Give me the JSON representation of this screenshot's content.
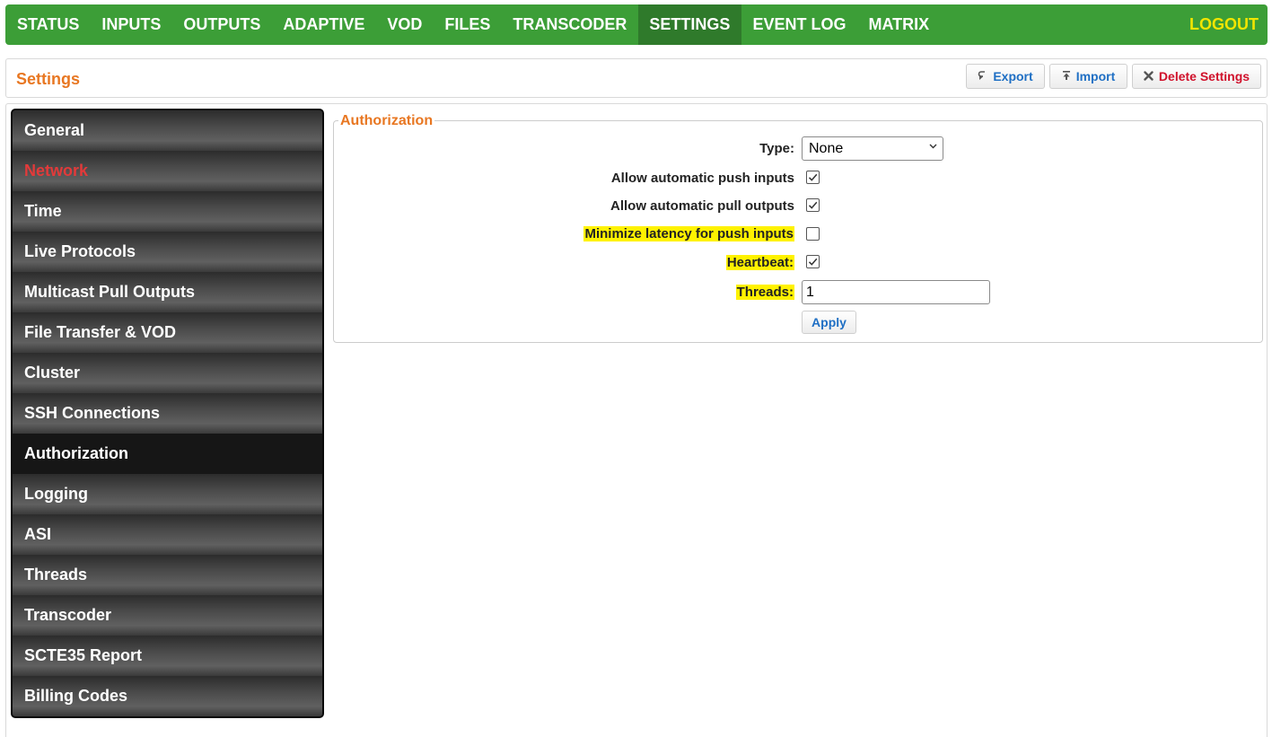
{
  "nav": {
    "items": [
      "STATUS",
      "INPUTS",
      "OUTPUTS",
      "ADAPTIVE",
      "VOD",
      "FILES",
      "TRANSCODER",
      "SETTINGS",
      "EVENT LOG",
      "MATRIX"
    ],
    "active": "SETTINGS",
    "logout": "LOGOUT"
  },
  "header": {
    "title": "Settings",
    "export_label": "Export",
    "import_label": "Import",
    "delete_label": "Delete Settings"
  },
  "sidebar": {
    "items": [
      "General",
      "Network",
      "Time",
      "Live Protocols",
      "Multicast Pull Outputs",
      "File Transfer & VOD",
      "Cluster",
      "SSH Connections",
      "Authorization",
      "Logging",
      "ASI",
      "Threads",
      "Transcoder",
      "SCTE35 Report",
      "Billing Codes"
    ],
    "active": "Authorization",
    "highlighted": "Network"
  },
  "form": {
    "legend": "Authorization",
    "type_label": "Type:",
    "type_value": "None",
    "push_label": "Allow automatic push inputs",
    "push_checked": true,
    "pull_label": "Allow automatic pull outputs",
    "pull_checked": true,
    "latency_label": "Minimize latency for push inputs",
    "latency_checked": false,
    "heartbeat_label": "Heartbeat:",
    "heartbeat_checked": true,
    "threads_label": "Threads:",
    "threads_value": "1",
    "apply_label": "Apply"
  },
  "colors": {
    "nav_green": "#3c9e37",
    "nav_active": "#2f7a2b",
    "logout_yellow": "#f2e500",
    "title_orange": "#e87722",
    "link_blue": "#1f6fc4",
    "delete_red": "#d0112b",
    "highlight_yellow": "#fff200"
  }
}
